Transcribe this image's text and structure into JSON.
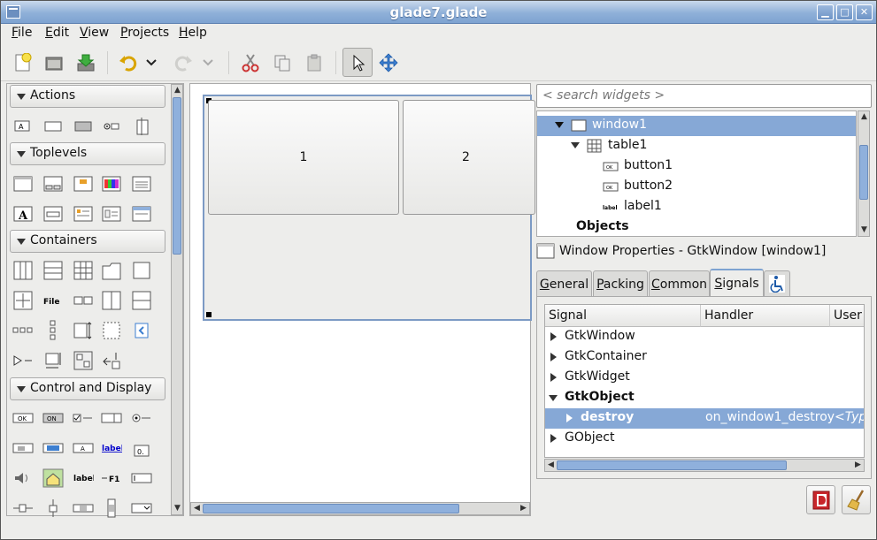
{
  "window": {
    "title": "glade7.glade"
  },
  "menu": {
    "file": {
      "label": "File",
      "mnemonic": "F",
      "rest": "ile"
    },
    "edit": {
      "label": "Edit",
      "mnemonic": "E",
      "rest": "dit"
    },
    "view": {
      "label": "View",
      "mnemonic": "V",
      "rest": "iew"
    },
    "projects": {
      "label": "Projects",
      "mnemonic": "P",
      "rest": "rojects"
    },
    "help": {
      "label": "Help",
      "mnemonic": "H",
      "rest": "elp"
    }
  },
  "toolbar": {
    "icons": [
      "new-icon",
      "open-icon",
      "save-icon",
      "undo-icon",
      "redo-icon",
      "cut-icon",
      "copy-icon",
      "paste-icon",
      "pointer-icon",
      "drag-resize-icon"
    ]
  },
  "palette": {
    "groups": {
      "actions": "Actions",
      "toplevels": "Toplevels",
      "containers": "Containers",
      "control": "Control and Display"
    },
    "icon_text": {
      "file": "File",
      "ok": "OK",
      "on": "ON",
      "a": "A",
      "label_link": "label",
      "label": "label",
      "f1": "F1",
      "zero": "0."
    }
  },
  "design": {
    "button1": "1",
    "button2": "2"
  },
  "search": {
    "placeholder": "< search widgets >"
  },
  "tree": {
    "window1": "window1",
    "table1": "table1",
    "button1": "button1",
    "button2": "button2",
    "label1": "label1",
    "objects": "Objects",
    "icon_ok": "OK",
    "icon_label": "label"
  },
  "properties": {
    "title": "Window Properties - GtkWindow [window1]",
    "tabs": {
      "general": {
        "pre": "",
        "u": "G",
        "post": "eneral"
      },
      "packing": {
        "pre": "",
        "u": "P",
        "post": "acking"
      },
      "common": {
        "pre": "",
        "u": "C",
        "post": "ommon"
      },
      "signals": {
        "pre": "",
        "u": "S",
        "post": "ignals"
      }
    }
  },
  "signals": {
    "columns": {
      "signal": "Signal",
      "handler": "Handler",
      "user": "User"
    },
    "rows": {
      "gtkwindow": "GtkWindow",
      "gtkcontainer": "GtkContainer",
      "gtkwidget": "GtkWidget",
      "gtkobject": "GtkObject",
      "destroy": "destroy",
      "destroy_handler": "on_window1_destroy",
      "destroy_user": "<Typ",
      "gobject": "GObject"
    }
  },
  "colors": {
    "selection": "#86a8d6",
    "titlebar": "#7ea3d1",
    "scrollthumb": "#8fb0dc"
  }
}
